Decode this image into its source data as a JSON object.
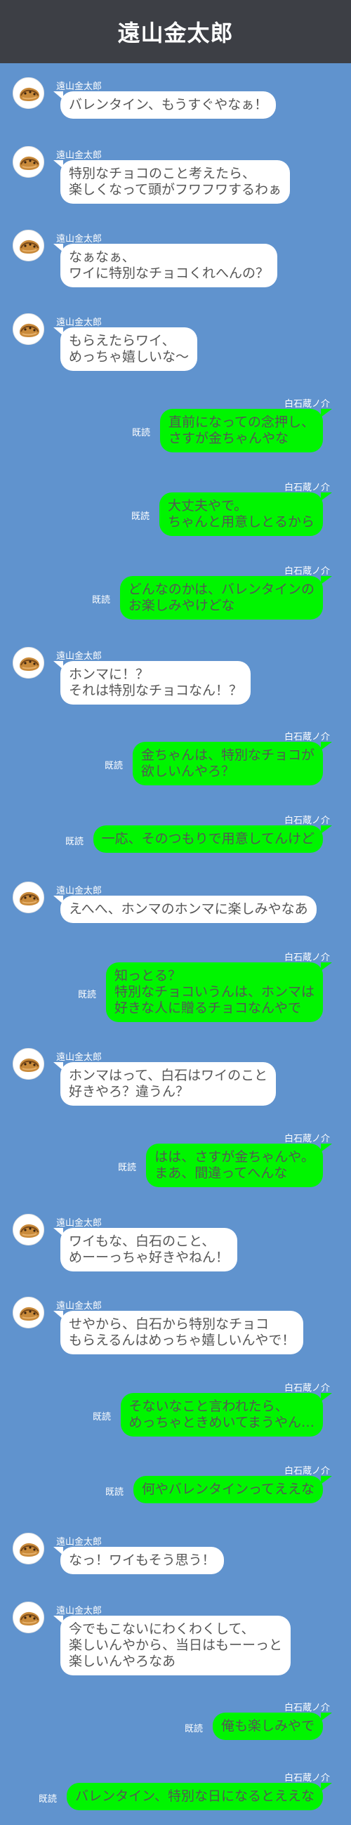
{
  "header": {
    "title": "遠山金太郎"
  },
  "read_label": "既読",
  "messages": [
    {
      "side": "left",
      "name": "遠山金太郎",
      "text": "バレンタイン、もうすぐやなぁ！"
    },
    {
      "side": "left",
      "name": "遠山金太郎",
      "text": "特別なチョコのこと考えたら、\n楽しくなって頭がフワフワするわぁ"
    },
    {
      "side": "left",
      "name": "遠山金太郎",
      "text": "なぁなぁ、\nワイに特別なチョコくれへんの？"
    },
    {
      "side": "left",
      "name": "遠山金太郎",
      "text": "もらえたらワイ、\nめっちゃ嬉しいな〜"
    },
    {
      "side": "right",
      "name": "白石蔵ノ介",
      "text": "直前になっての念押し、\nさすが金ちゃんやな",
      "read": "既読"
    },
    {
      "side": "right",
      "name": "白石蔵ノ介",
      "text": "大丈夫やで。\nちゃんと用意しとるから",
      "read": "既読"
    },
    {
      "side": "right",
      "name": "白石蔵ノ介",
      "text": "どんなのかは、バレンタインの\nお楽しみやけどな",
      "read": "既読"
    },
    {
      "side": "left",
      "name": "遠山金太郎",
      "text": "ホンマに！？\nそれは特別なチョコなん！？"
    },
    {
      "side": "right",
      "name": "白石蔵ノ介",
      "text": "金ちゃんは、特別なチョコが\n欲しいんやろ？",
      "read": "既読"
    },
    {
      "side": "right",
      "name": "白石蔵ノ介",
      "text": "一応、そのつもりで用意してんけど",
      "read": "既読"
    },
    {
      "side": "left",
      "name": "遠山金太郎",
      "text": "えへへ、ホンマのホンマに楽しみやなあ"
    },
    {
      "side": "right",
      "name": "白石蔵ノ介",
      "text": "知っとる？\n特別なチョコいうんは、ホンマは\n好きな人に贈るチョコなんやで",
      "read": "既読"
    },
    {
      "side": "left",
      "name": "遠山金太郎",
      "text": "ホンマはって、白石はワイのこと\n好きやろ？違うん？"
    },
    {
      "side": "right",
      "name": "白石蔵ノ介",
      "text": "はは、さすが金ちゃんや。\nまあ、間違ってへんな",
      "read": "既読"
    },
    {
      "side": "left",
      "name": "遠山金太郎",
      "text": "ワイもな、白石のこと、\nめーーっちゃ好きやねん！"
    },
    {
      "side": "left",
      "name": "遠山金太郎",
      "text": "せやから、白石から特別なチョコ\nもらえるんはめっちゃ嬉しいんやで！"
    },
    {
      "side": "right",
      "name": "白石蔵ノ介",
      "text": "そないなこと言われたら、\nめっちゃときめいてまうやん…",
      "read": "既読"
    },
    {
      "side": "right",
      "name": "白石蔵ノ介",
      "text": "何やバレンタインってええな",
      "read": "既読"
    },
    {
      "side": "left",
      "name": "遠山金太郎",
      "text": "なっ！ワイもそう思う！"
    },
    {
      "side": "left",
      "name": "遠山金太郎",
      "text": "今でもこないにわくわくして、\n楽しいんやから、当日はもーーっと\n楽しいんやろなあ"
    },
    {
      "side": "right",
      "name": "白石蔵ノ介",
      "text": "俺も楽しみやで",
      "read": "既読"
    },
    {
      "side": "right",
      "name": "白石蔵ノ介",
      "text": "バレンタイン、特別な日になるとええな",
      "read": "既読"
    }
  ]
}
